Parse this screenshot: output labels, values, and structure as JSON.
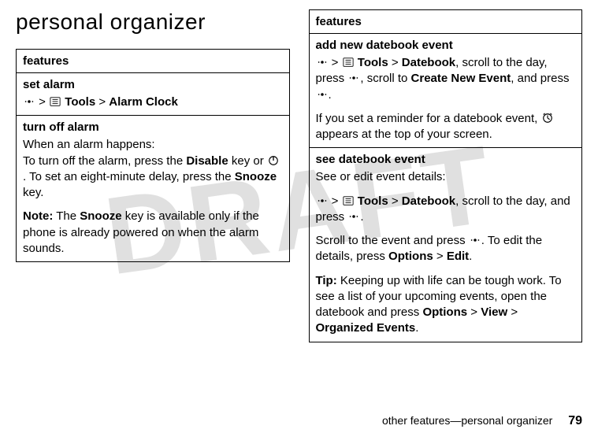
{
  "watermark": "DRAFT",
  "page_title": "personal organizer",
  "left_table": {
    "header": "features",
    "rows": [
      {
        "title": "set alarm",
        "path_prefix_icon": "nav-dot-icon",
        "sep1": ">",
        "tools_icon": "tools-icon",
        "tools_label": "Tools",
        "sep2": ">",
        "target": "Alarm Clock"
      },
      {
        "title": "turn off alarm",
        "line1": "When an alarm happens:",
        "line2a": "To turn off the alarm, press the ",
        "disable": "Disable",
        "line2b": " key or ",
        "power_icon": "power-icon",
        "line2c": ". To set an eight-minute delay, press the ",
        "snooze": "Snooze",
        "line2d": " key.",
        "note_label": "Note:",
        "note_a": " The ",
        "note_snooze": "Snooze",
        "note_b": " key is available only if the phone is already powered on when the alarm sounds."
      }
    ]
  },
  "right_table": {
    "header": "features",
    "rows": [
      {
        "title": "add new datebook event",
        "p1_icon1": "nav-dot-icon",
        "p1_sep1": ">",
        "p1_tools_icon": "tools-icon",
        "p1_tools": "Tools",
        "p1_sep2": ">",
        "p1_datebook": "Datebook",
        "p1_txt1": ", scroll to the day, press ",
        "p1_icon2": "nav-dot-icon",
        "p1_txt2": ", scroll to ",
        "p1_create": "Create New Event",
        "p1_txt3": ", and press ",
        "p1_icon3": "nav-dot-icon",
        "p1_txt4": ".",
        "p2_txt1": "If you set a reminder for a datebook event, ",
        "p2_icon": "reminder-icon",
        "p2_txt2": " appears at the top of your screen."
      },
      {
        "title": "see datebook event",
        "p1": "See or edit event details:",
        "p2_icon1": "nav-dot-icon",
        "p2_sep1": ">",
        "p2_tools_icon": "tools-icon",
        "p2_tools": "Tools",
        "p2_sep2": ">",
        "p2_datebook": "Datebook",
        "p2_txt1": ", scroll to the day, and press ",
        "p2_icon2": "nav-dot-icon",
        "p2_txt2": ".",
        "p3_txt1": "Scroll to the event and press ",
        "p3_icon1": "nav-dot-icon",
        "p3_txt2": ". To edit the details, press ",
        "p3_options": "Options",
        "p3_sep": ">",
        "p3_edit": "Edit",
        "p3_txt3": ".",
        "tip_label": "Tip:",
        "tip_txt1": " Keeping up with life can be tough work. To see a list of your upcoming events, open the datebook and press ",
        "tip_options": "Options",
        "tip_sep1": ">",
        "tip_view": "View",
        "tip_sep2": ">",
        "tip_org": "Organized Events",
        "tip_txt2": "."
      }
    ]
  },
  "footer": {
    "text": "other features—personal organizer",
    "page": "79"
  }
}
